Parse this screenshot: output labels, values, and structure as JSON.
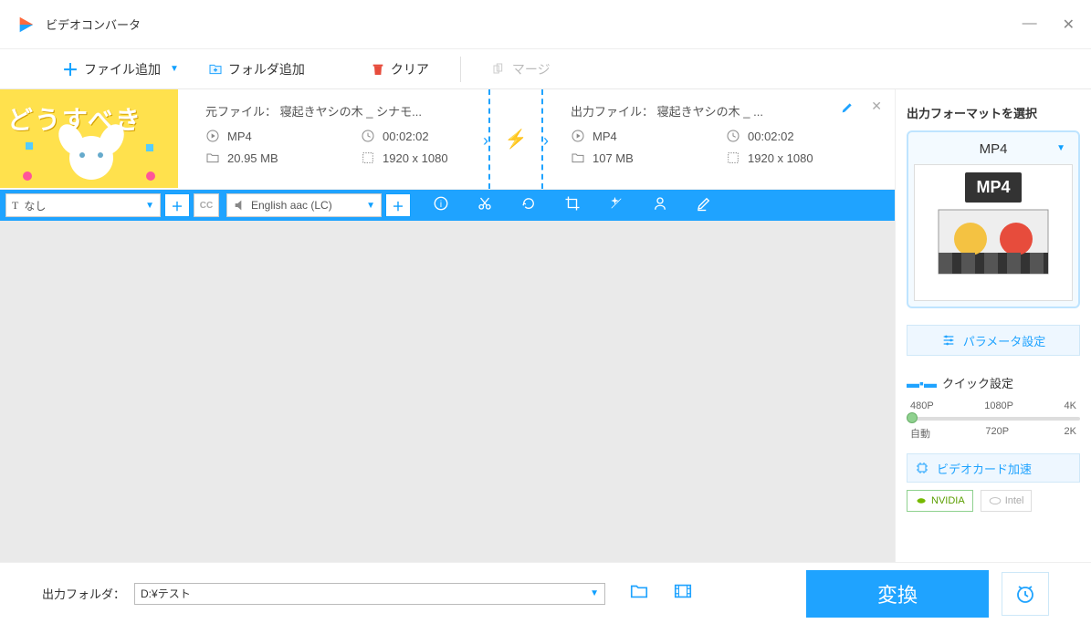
{
  "app": {
    "title": "ビデオコンバータ"
  },
  "toolbar": {
    "add_file": "ファイル追加",
    "add_folder": "フォルダ追加",
    "clear": "クリア",
    "merge": "マージ"
  },
  "file": {
    "thumb_text": "どうすべき",
    "source_label": "元ファイル：",
    "source_name": "寝起きヤシの木 _ シナモ...",
    "output_label": "出力ファイル：",
    "output_name": "寝起きヤシの木 _ ...",
    "src": {
      "format": "MP4",
      "duration": "00:02:02",
      "size": "20.95 MB",
      "resolution": "1920 x 1080"
    },
    "out": {
      "format": "MP4",
      "duration": "00:02:02",
      "size": "107 MB",
      "resolution": "1920 x 1080"
    }
  },
  "tracks": {
    "subtitle": "なし",
    "audio": "English aac (LC)"
  },
  "side": {
    "title": "出力フォーマットを選択",
    "format": "MP4",
    "badge": "MP4",
    "param_btn": "パラメータ設定",
    "quick_title": "クイック設定",
    "scale": {
      "top": [
        "480P",
        "1080P",
        "4K"
      ],
      "bottom": [
        "自動",
        "720P",
        "2K"
      ]
    },
    "gpu_btn": "ビデオカード加速",
    "nvidia": "NVIDIA",
    "intel": "Intel"
  },
  "bottom": {
    "label": "出力フォルダ：",
    "path": "D:¥テスト",
    "convert": "変換"
  }
}
